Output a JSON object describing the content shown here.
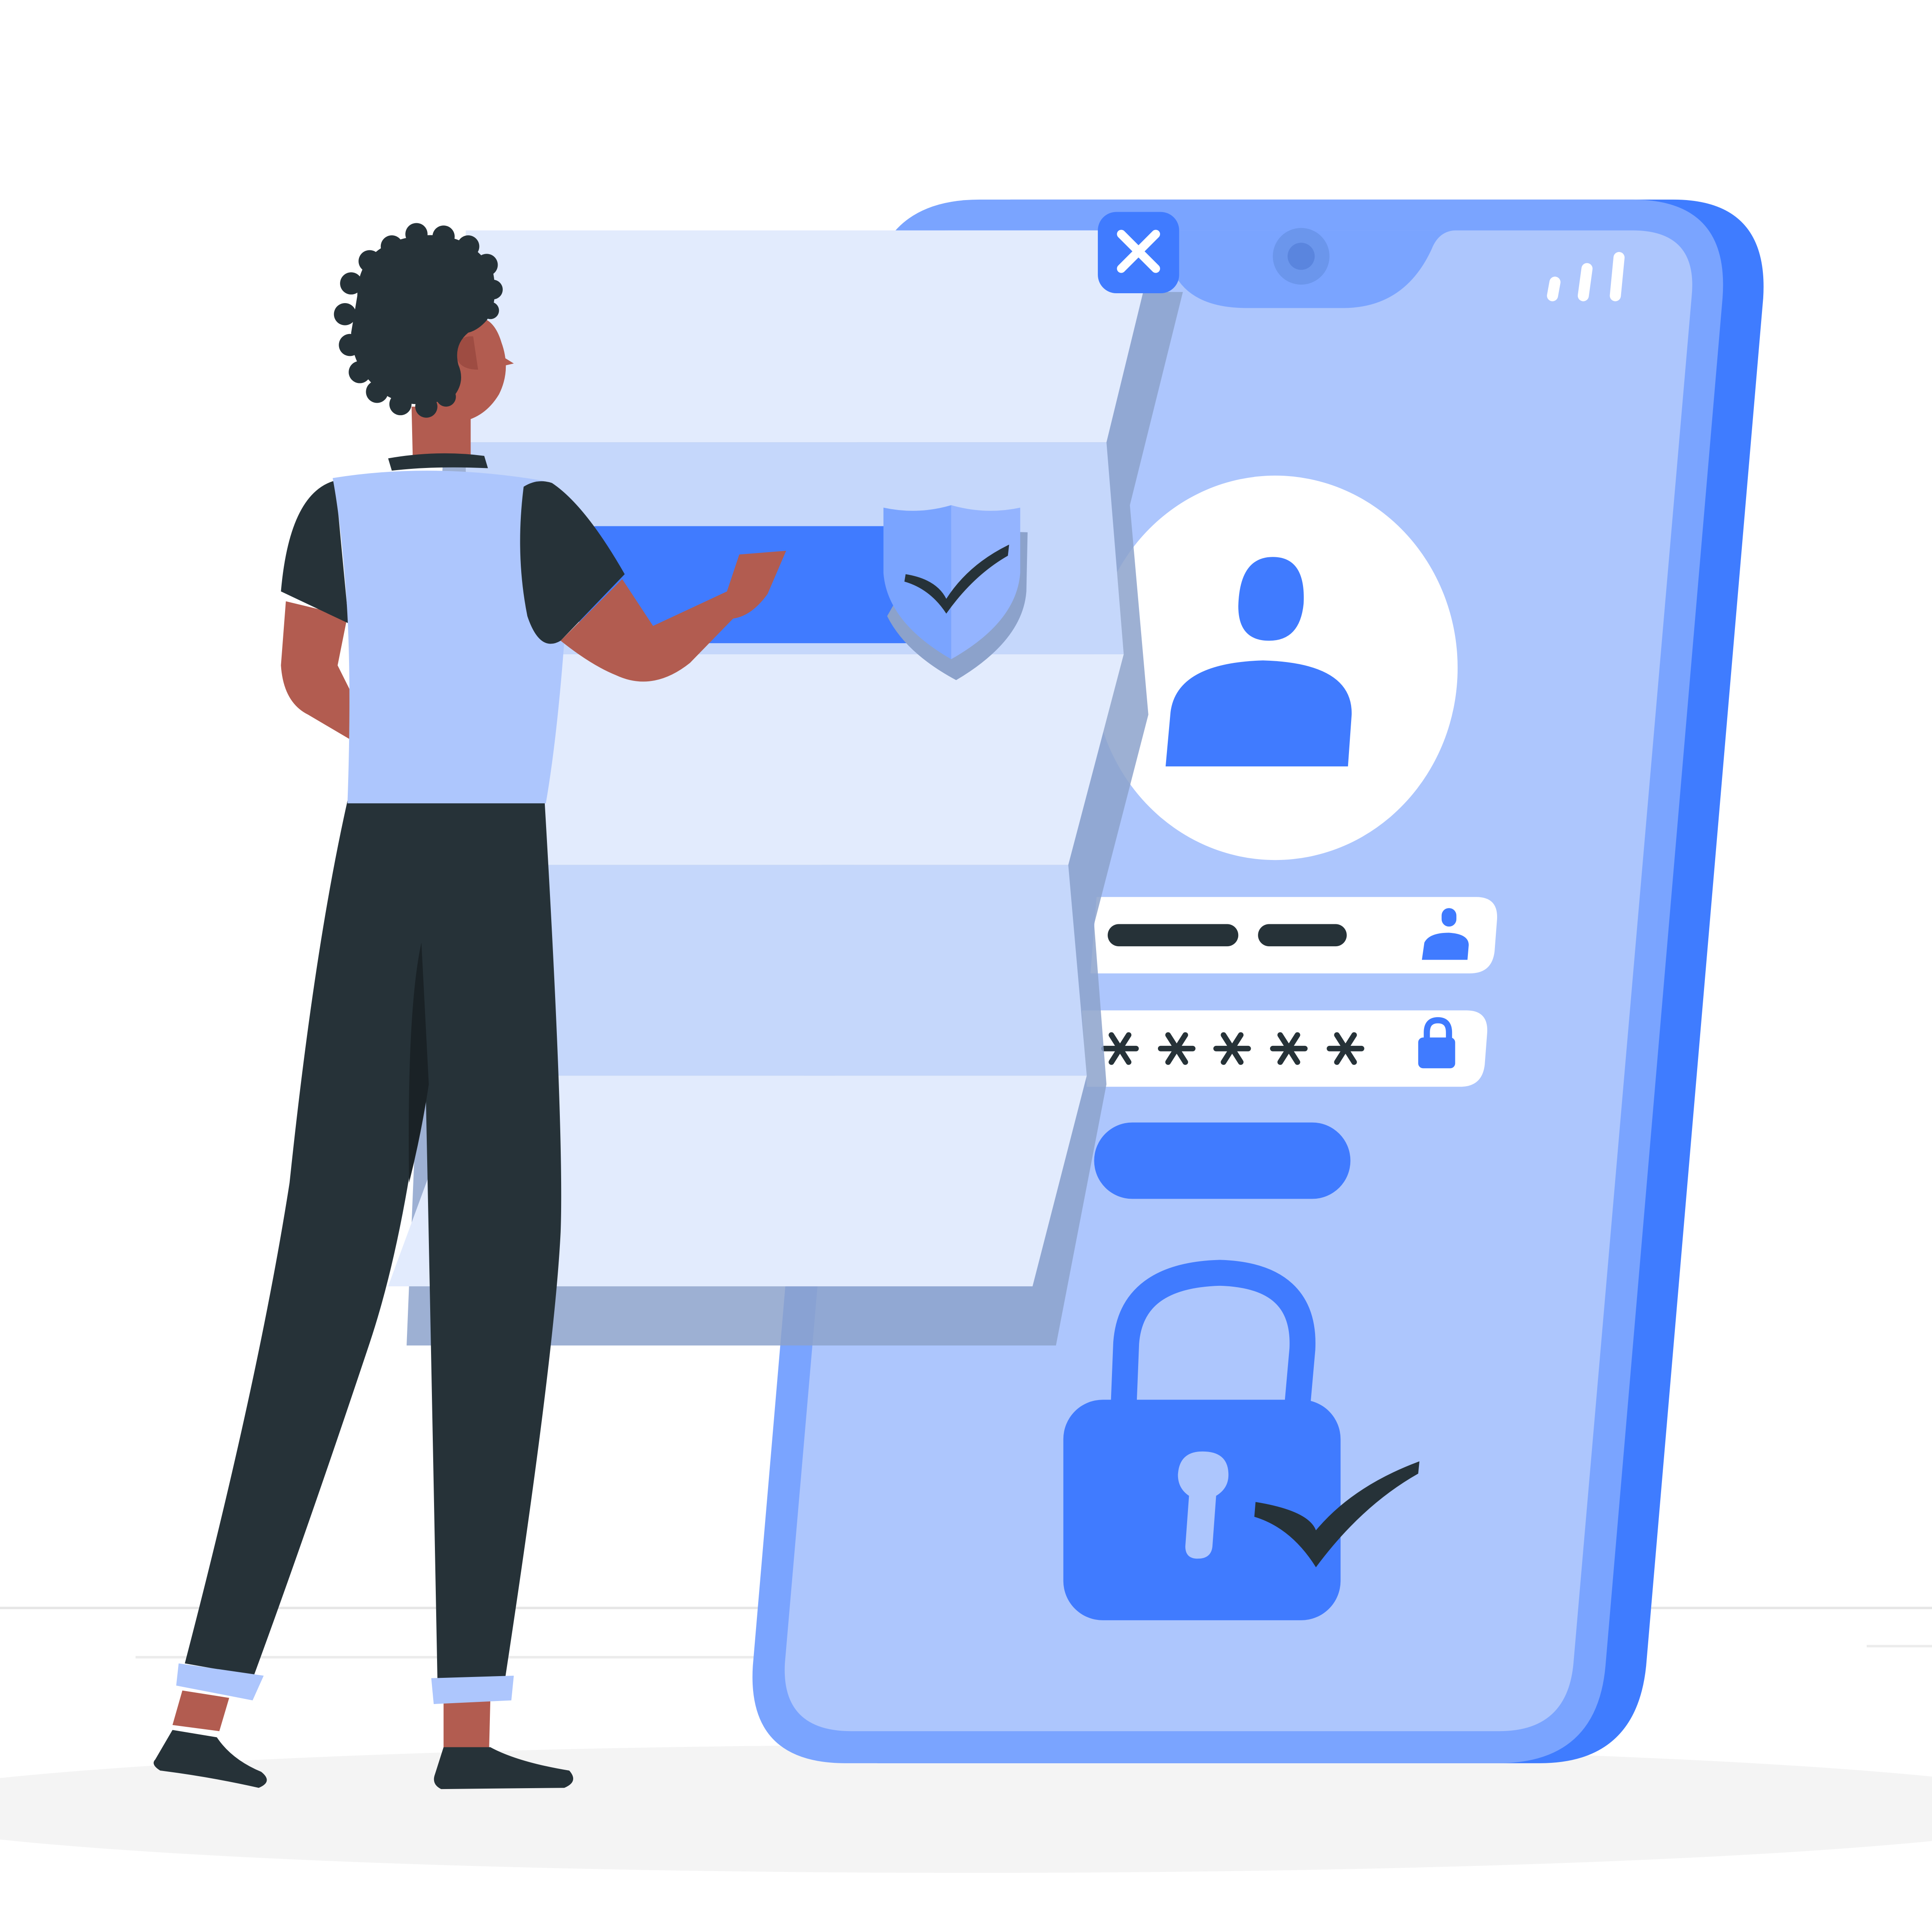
{
  "colors": {
    "background": "#ffffff",
    "floor_shadow": "#f4f4f4",
    "floor_line": "#e6e6e6",
    "phone_back": "#3f7cff",
    "phone_frame": "#7aa4ff",
    "phone_screen": "#adc6fd",
    "accent": "#407bff",
    "panel_light": "#e2ebfd",
    "panel_mid": "#c5d7fb",
    "panel_shadow": "#8ca2cb",
    "white": "#ffffff",
    "dark": "#263238",
    "skin": "#b25c50",
    "shirt": "#adc6fd",
    "sleeve_dark": "#263238"
  },
  "icons": {
    "close": "close-icon",
    "camera": "camera-icon",
    "signal": "signal-bars-icon",
    "avatar": "user-avatar-icon",
    "username_field_icon": "user-icon",
    "password_field_icon": "lock-icon",
    "padlock": "padlock-icon",
    "shield": "shield-check-icon",
    "checkmark": "checkmark-icon"
  },
  "password_mask": "*****"
}
